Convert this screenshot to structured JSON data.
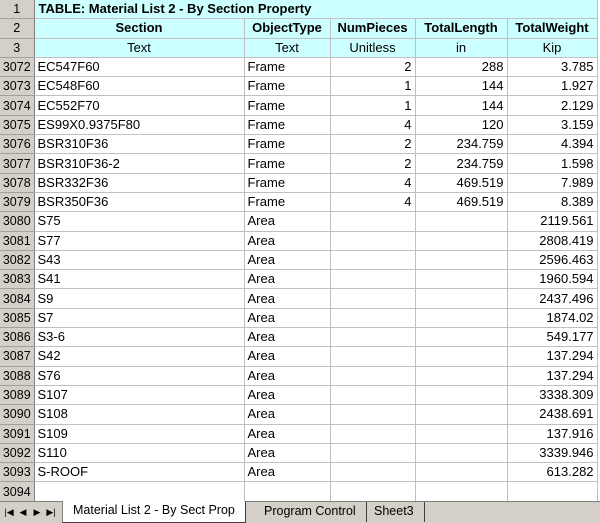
{
  "title": "TABLE:  Material List 2 - By Section Property",
  "columns": [
    {
      "header": "Section",
      "unit": "Text"
    },
    {
      "header": "ObjectType",
      "unit": "Text"
    },
    {
      "header": "NumPieces",
      "unit": "Unitless"
    },
    {
      "header": "TotalLength",
      "unit": "in"
    },
    {
      "header": "TotalWeight",
      "unit": "Kip"
    }
  ],
  "header_row_numbers": [
    "1",
    "2",
    "3"
  ],
  "rows": [
    {
      "n": "3072",
      "section": "EC547F60",
      "type": "Frame",
      "pieces": "2",
      "length": "288",
      "weight": "3.785"
    },
    {
      "n": "3073",
      "section": "EC548F60",
      "type": "Frame",
      "pieces": "1",
      "length": "144",
      "weight": "1.927"
    },
    {
      "n": "3074",
      "section": "EC552F70",
      "type": "Frame",
      "pieces": "1",
      "length": "144",
      "weight": "2.129"
    },
    {
      "n": "3075",
      "section": "ES99X0.9375F80",
      "type": "Frame",
      "pieces": "4",
      "length": "120",
      "weight": "3.159"
    },
    {
      "n": "3076",
      "section": "BSR310F36",
      "type": "Frame",
      "pieces": "2",
      "length": "234.759",
      "weight": "4.394"
    },
    {
      "n": "3077",
      "section": "BSR310F36-2",
      "type": "Frame",
      "pieces": "2",
      "length": "234.759",
      "weight": "1.598"
    },
    {
      "n": "3078",
      "section": "BSR332F36",
      "type": "Frame",
      "pieces": "4",
      "length": "469.519",
      "weight": "7.989"
    },
    {
      "n": "3079",
      "section": "BSR350F36",
      "type": "Frame",
      "pieces": "4",
      "length": "469.519",
      "weight": "8.389"
    },
    {
      "n": "3080",
      "section": "S75",
      "type": "Area",
      "pieces": "",
      "length": "",
      "weight": "2119.561"
    },
    {
      "n": "3081",
      "section": "S77",
      "type": "Area",
      "pieces": "",
      "length": "",
      "weight": "2808.419"
    },
    {
      "n": "3082",
      "section": "S43",
      "type": "Area",
      "pieces": "",
      "length": "",
      "weight": "2596.463"
    },
    {
      "n": "3083",
      "section": "S41",
      "type": "Area",
      "pieces": "",
      "length": "",
      "weight": "1960.594"
    },
    {
      "n": "3084",
      "section": "S9",
      "type": "Area",
      "pieces": "",
      "length": "",
      "weight": "2437.496"
    },
    {
      "n": "3085",
      "section": "S7",
      "type": "Area",
      "pieces": "",
      "length": "",
      "weight": "1874.02"
    },
    {
      "n": "3086",
      "section": "S3-6",
      "type": "Area",
      "pieces": "",
      "length": "",
      "weight": "549.177"
    },
    {
      "n": "3087",
      "section": "S42",
      "type": "Area",
      "pieces": "",
      "length": "",
      "weight": "137.294"
    },
    {
      "n": "3088",
      "section": "S76",
      "type": "Area",
      "pieces": "",
      "length": "",
      "weight": "137.294"
    },
    {
      "n": "3089",
      "section": "S107",
      "type": "Area",
      "pieces": "",
      "length": "",
      "weight": "3338.309"
    },
    {
      "n": "3090",
      "section": "S108",
      "type": "Area",
      "pieces": "",
      "length": "",
      "weight": "2438.691"
    },
    {
      "n": "3091",
      "section": "S109",
      "type": "Area",
      "pieces": "",
      "length": "",
      "weight": "137.916"
    },
    {
      "n": "3092",
      "section": "S110",
      "type": "Area",
      "pieces": "",
      "length": "",
      "weight": "3339.946"
    },
    {
      "n": "3093",
      "section": "S-ROOF",
      "type": "Area",
      "pieces": "",
      "length": "",
      "weight": "613.282"
    },
    {
      "n": "3094",
      "section": "",
      "type": "",
      "pieces": "",
      "length": "",
      "weight": ""
    }
  ],
  "sheet_tabs": [
    "Material List 2 - By Sect Prop",
    "Program Control",
    "Sheet3"
  ],
  "colors": {
    "header_fill": "#ccffff",
    "row_header_fill": "#d4d0c8",
    "gridline": "#c0c0c0"
  }
}
